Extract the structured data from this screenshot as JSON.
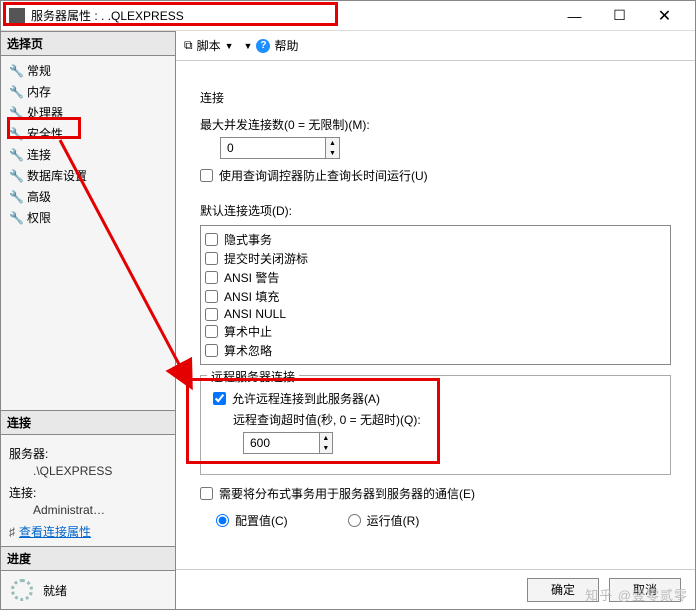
{
  "titlebar": {
    "title": "服务器属性 :        . .QLEXPRESS"
  },
  "sidebar": {
    "select_page": "选择页",
    "items": [
      {
        "label": "常规"
      },
      {
        "label": "内存"
      },
      {
        "label": "处理器"
      },
      {
        "label": "安全性"
      },
      {
        "label": "连接"
      },
      {
        "label": "数据库设置"
      },
      {
        "label": "高级"
      },
      {
        "label": "权限"
      }
    ],
    "conn_header": "连接",
    "server_label": "服务器:",
    "server_value": ".\\QLEXPRESS",
    "conn_label": "连接:",
    "conn_value": "Administrat…",
    "view_props": "查看连接属性",
    "progress_header": "进度",
    "ready": "就绪"
  },
  "toolbar": {
    "script": "脚本",
    "help": "帮助"
  },
  "main": {
    "conn_section": "连接",
    "max_conns_label": "最大并发连接数(0 = 无限制)(M):",
    "max_conns_value": "0",
    "use_governor": "使用查询调控器防止查询长时间运行(U)",
    "default_opts": "默认连接选项(D):",
    "opts": [
      "隐式事务",
      "提交时关闭游标",
      "ANSI 警告",
      "ANSI 填充",
      "ANSI NULL",
      "算术中止",
      "算术忽略"
    ],
    "remote_legend": "远程服务器连接",
    "allow_remote": "允许远程连接到此服务器(A)",
    "remote_timeout_label": "远程查询超时值(秒, 0 = 无超时)(Q):",
    "remote_timeout_value": "600",
    "dist_trans": "需要将分布式事务用于服务器到服务器的通信(E)",
    "radio_config": "配置值(C)",
    "radio_running": "运行值(R)"
  },
  "footer": {
    "ok": "确定",
    "cancel": "取消"
  },
  "watermark": "知乎 @壹零贰零"
}
